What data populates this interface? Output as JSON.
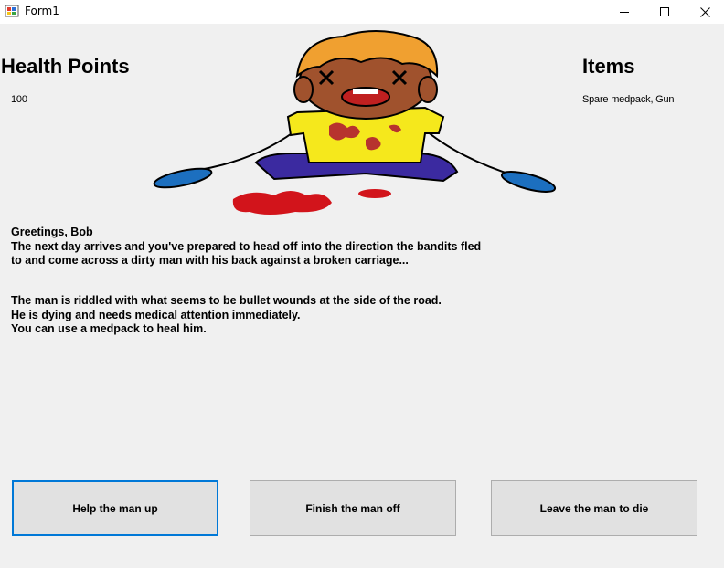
{
  "window": {
    "title": "Form1",
    "minimize_icon": "minimize-icon",
    "maximize_icon": "maximize-icon",
    "close_icon": "close-icon"
  },
  "stats": {
    "health_heading": "Health Points",
    "health_value": "100",
    "items_heading": "Items",
    "items_value": "Spare medpack, Gun"
  },
  "story": {
    "paragraph1": "Greetings, Bob\nThe next day arrives and you've prepared to head off into the direction the bandits fled\nto and come across a dirty man with his back against a broken carriage...",
    "paragraph2": "The man is riddled with what seems to be bullet wounds at the side of the road.\nHe is dying and needs medical attention immediately.\nYou can use a medpack to heal him."
  },
  "actions": [
    {
      "label": "Help the man up"
    },
    {
      "label": "Finish the man off"
    },
    {
      "label": "Leave the man to die"
    }
  ],
  "colors": {
    "window_bg": "#f0f0f0",
    "button_bg": "#e1e1e1",
    "focus_border": "#0078d7"
  }
}
